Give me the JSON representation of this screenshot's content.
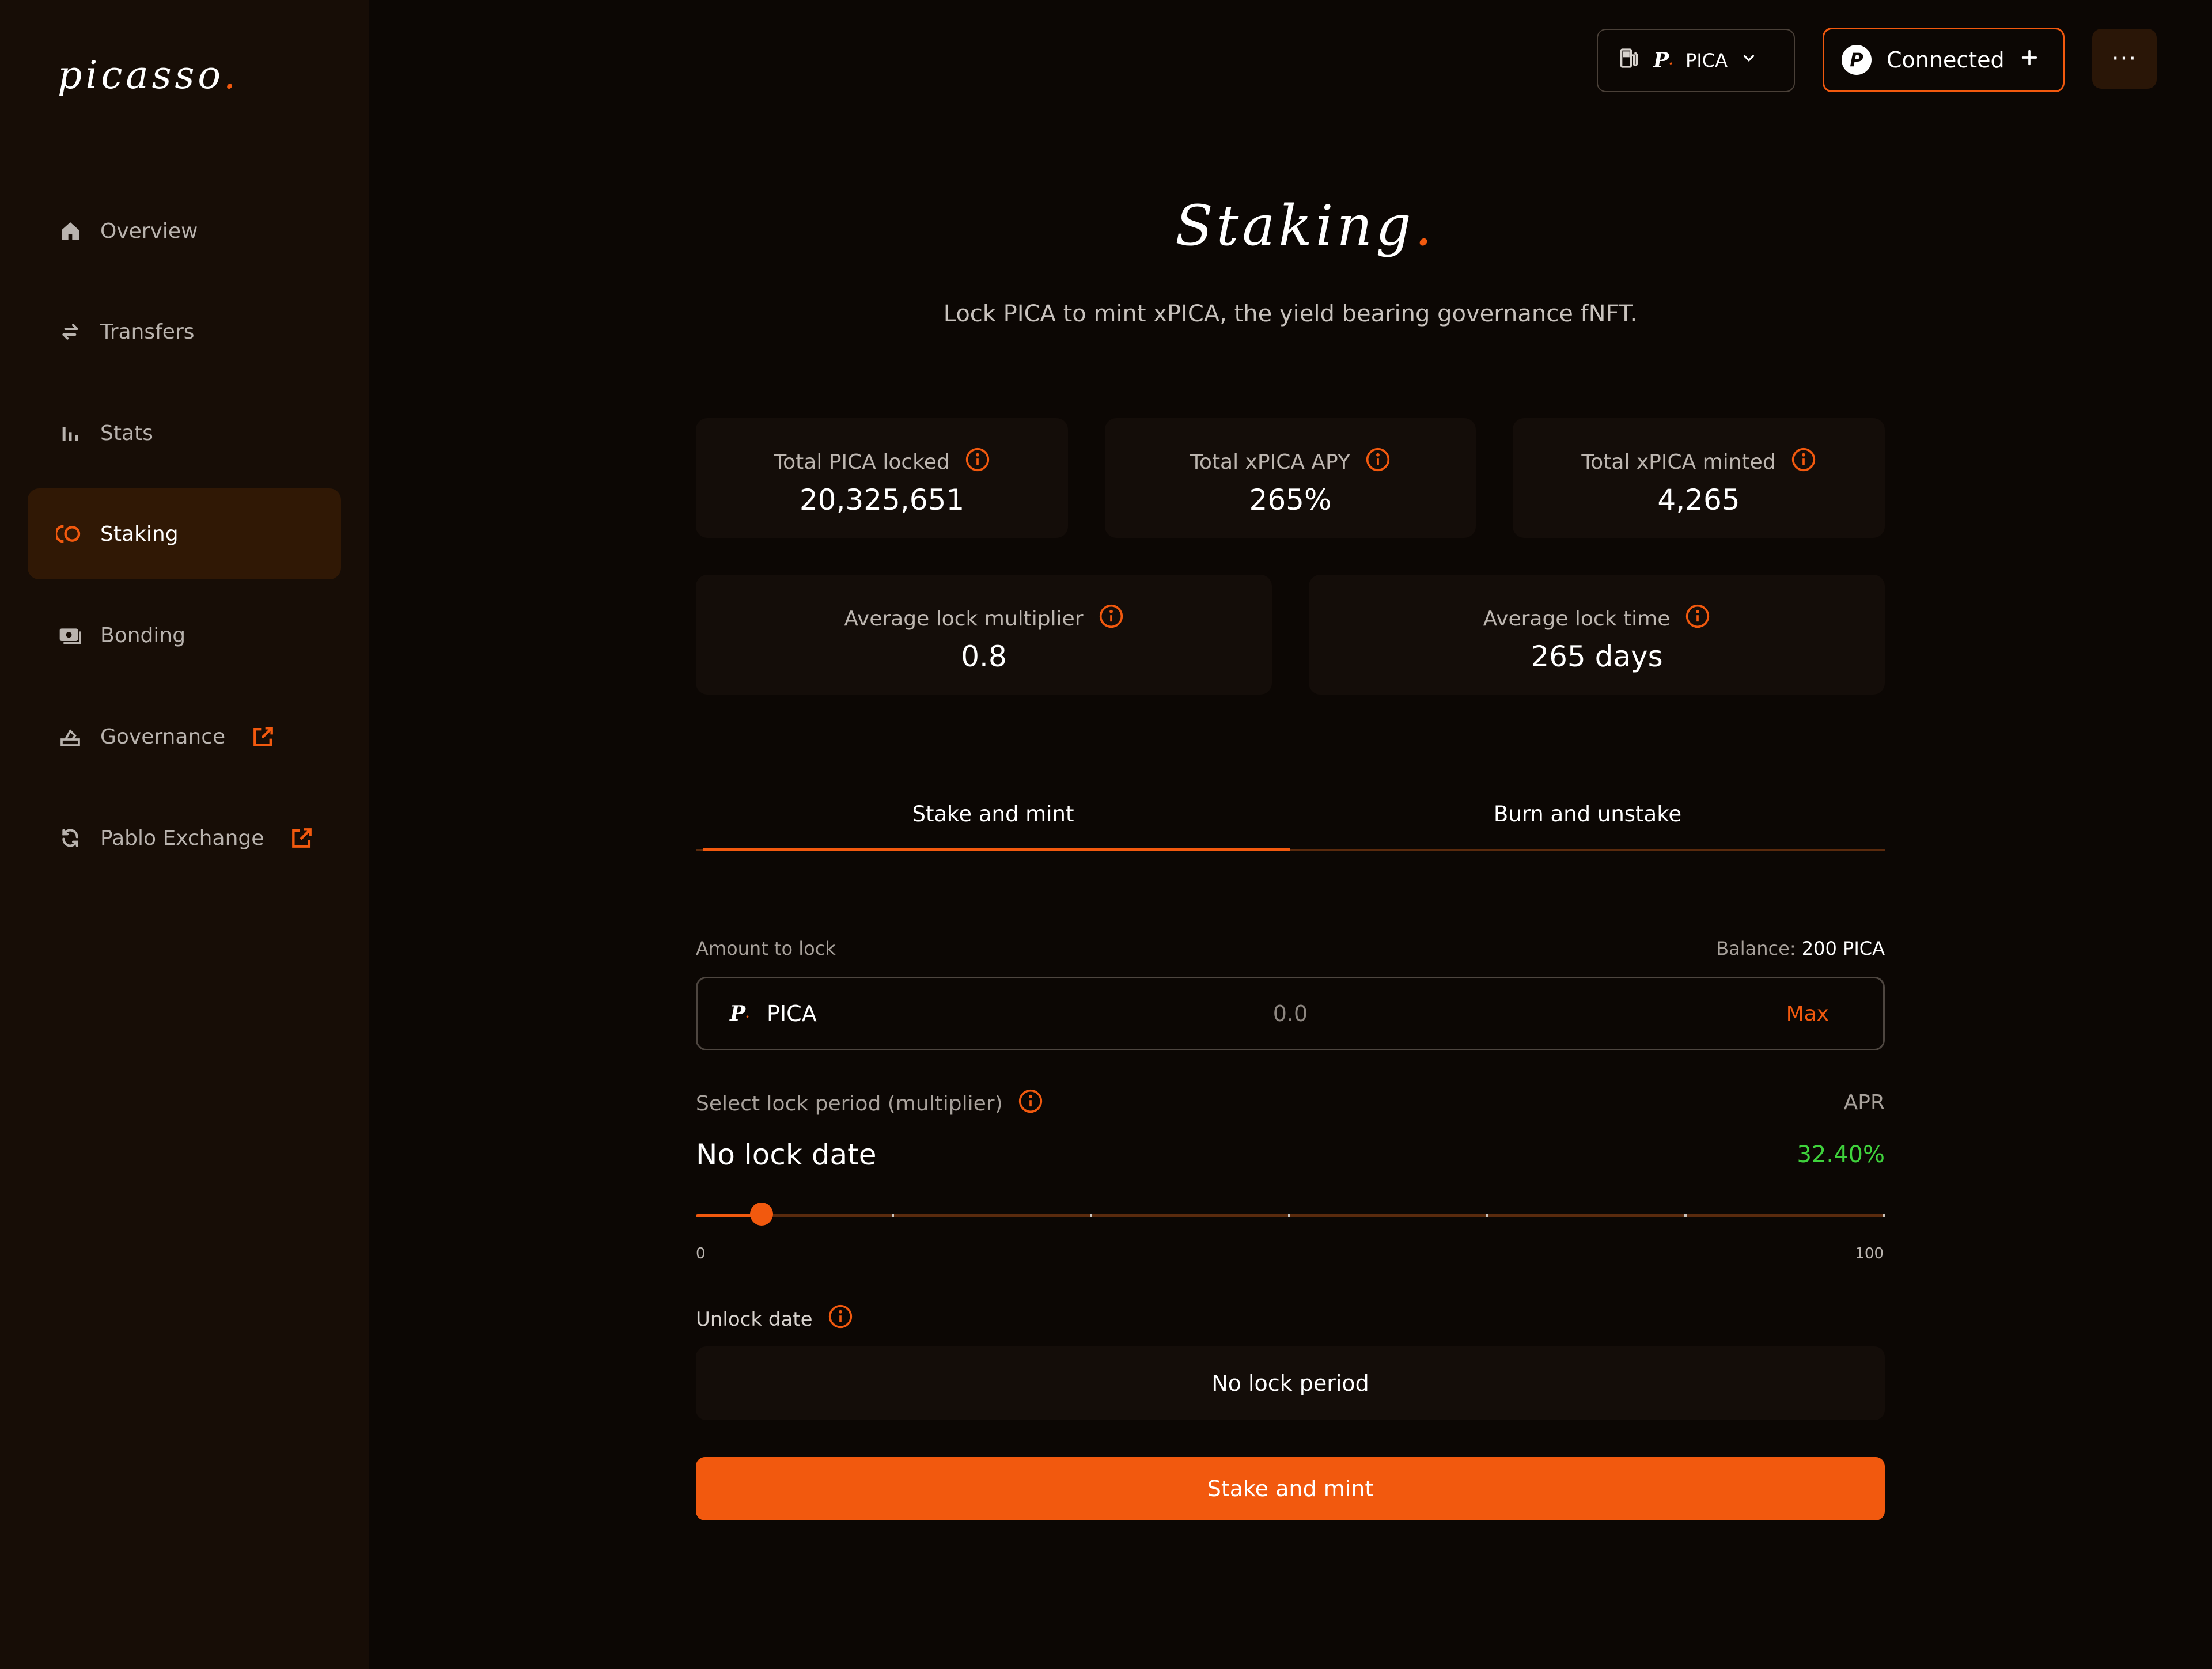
{
  "app": {
    "logo_text": "picasso",
    "logo_dot": "."
  },
  "colors": {
    "accent": "#f2590e",
    "positive": "#3fd23c",
    "background": "#0c0704",
    "sidebar": "#170d06",
    "card": "#140d09"
  },
  "sidebar": {
    "items": [
      {
        "label": "Overview",
        "icon": "home-icon"
      },
      {
        "label": "Transfers",
        "icon": "transfer-arrows-icon"
      },
      {
        "label": "Stats",
        "icon": "bar-chart-icon"
      },
      {
        "label": "Staking",
        "icon": "staking-icon",
        "active": true
      },
      {
        "label": "Bonding",
        "icon": "bonding-icon"
      },
      {
        "label": "Governance",
        "icon": "governance-icon",
        "external": true
      },
      {
        "label": "Pablo Exchange",
        "icon": "exchange-icon",
        "external": true
      }
    ]
  },
  "topbar": {
    "network_label": "PICA",
    "connected_label": "Connected",
    "more_label": "···"
  },
  "page": {
    "title": "Staking",
    "title_dot": ".",
    "subtitle": "Lock PICA to mint xPICA, the yield bearing governance fNFT."
  },
  "stats": [
    {
      "label": "Total PICA locked",
      "value": "20,325,651"
    },
    {
      "label": "Total xPICA APY",
      "value": "265%"
    },
    {
      "label": "Total xPICA minted",
      "value": "4,265"
    },
    {
      "label": "Average lock multiplier",
      "value": "0.8"
    },
    {
      "label": "Average lock time",
      "value": "265 days"
    }
  ],
  "tabs": [
    {
      "label": "Stake and mint",
      "active": true
    },
    {
      "label": "Burn and unstake"
    }
  ],
  "form": {
    "amount_label": "Amount to lock",
    "balance_prefix": "Balance:",
    "balance_value": "200 PICA",
    "token": "PICA",
    "amount_value": "0.0",
    "max_label": "Max",
    "lock_period_label": "Select lock period (multiplier)",
    "apr_label": "APR",
    "lock_value": "No lock date",
    "apr_value": "32.40%",
    "slider": {
      "min": "0",
      "max": "100",
      "value": 5.5,
      "marks": [
        16.67,
        33.33,
        50,
        66.67,
        83.33,
        100
      ]
    },
    "unlock_label": "Unlock date",
    "unlock_value": "No lock period",
    "submit_label": "Stake and mint"
  }
}
